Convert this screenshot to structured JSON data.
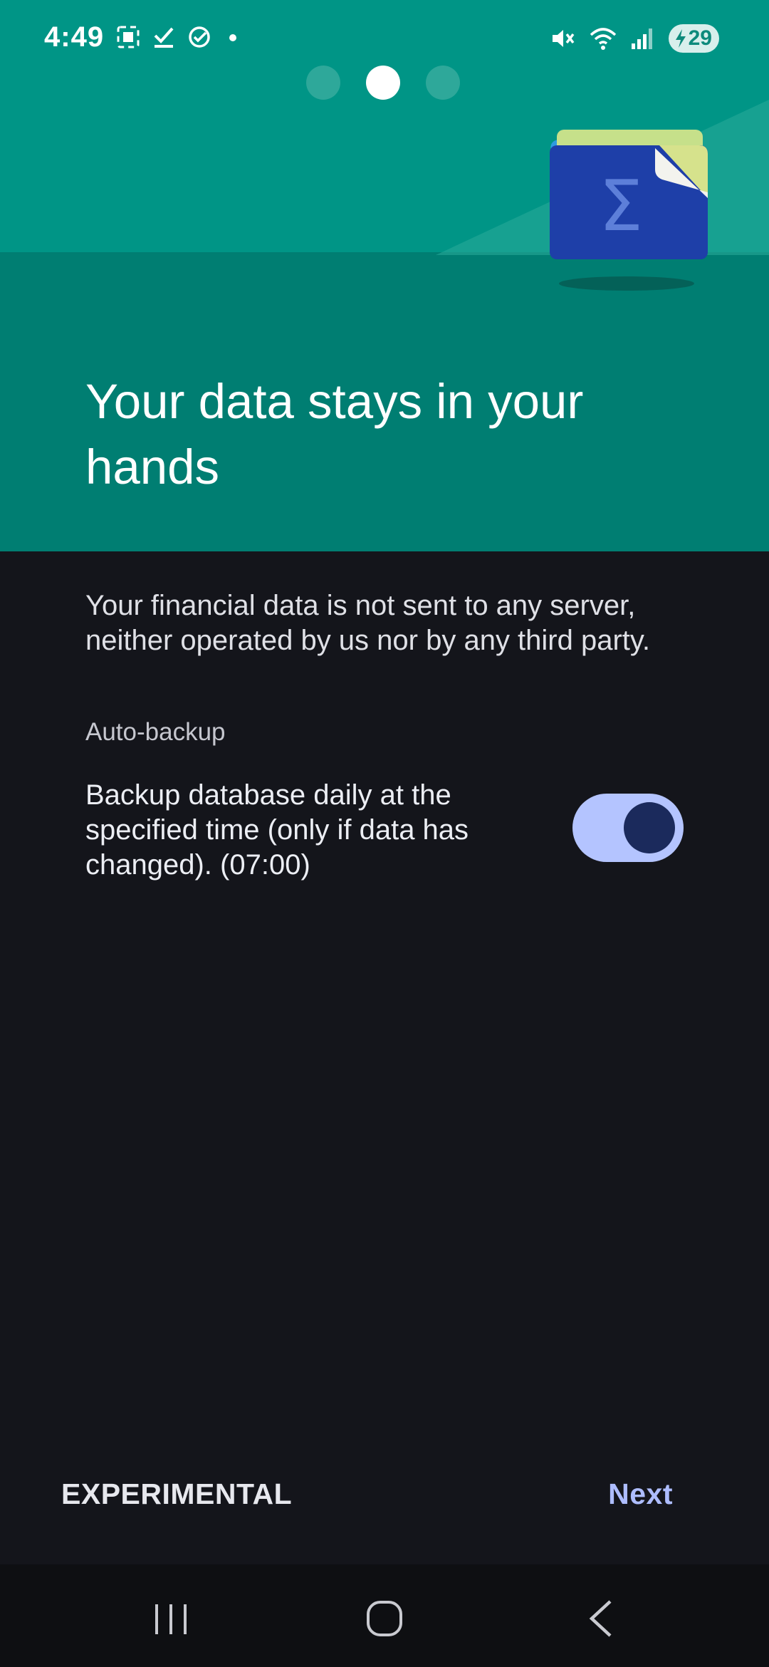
{
  "status_bar": {
    "time": "4:49",
    "battery_level": "29",
    "left_icons": [
      "screenshot-icon",
      "check-icon",
      "check-circle-icon",
      "dot-icon"
    ],
    "right_icons": [
      "mute-icon",
      "wifi-icon",
      "signal-icon",
      "battery-charging-icon"
    ]
  },
  "pager": {
    "total": 3,
    "active_index": 1
  },
  "onboarding": {
    "title": "Your data stays in your hands",
    "description": "Your financial data is not sent to any server, neither operated by us nor by any third party.",
    "section_label": "Auto-backup",
    "backup_setting": {
      "text": "Backup database daily at the specified time (only if data has changed). (07:00)",
      "enabled": true
    }
  },
  "footer": {
    "experimental_label": "EXPERIMENTAL",
    "next_label": "Next"
  },
  "nav_bar": {
    "buttons": [
      "recents-icon",
      "home-icon",
      "back-icon"
    ]
  },
  "colors": {
    "hero_top": "#009586",
    "hero_bottom": "#007e72",
    "background": "#14151b",
    "accent": "#aebdff",
    "toggle_track": "#b4c4ff",
    "toggle_knob": "#1b2a5c"
  }
}
